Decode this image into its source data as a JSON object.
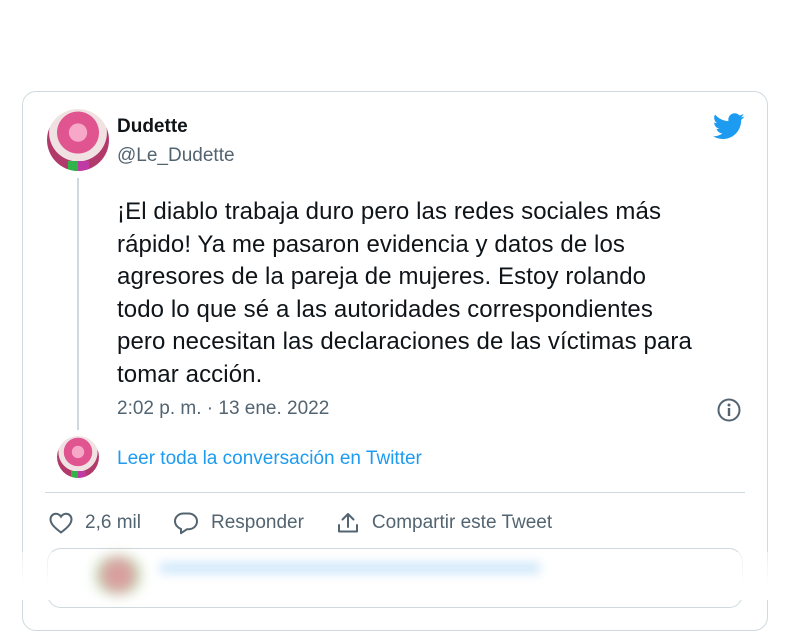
{
  "author": {
    "name": "Dudette",
    "handle": "@Le_Dudette"
  },
  "tweet": {
    "text_lines": [
      "¡El diablo trabaja duro pero las redes sociales más",
      "rápido! Ya me pasaron evidencia y datos de los",
      "agresores de la pareja de mujeres. Estoy rolando",
      "todo lo que sé a las autoridades correspondientes",
      "pero necesitan las declaraciones de las víctimas para",
      "tomar acción."
    ],
    "timestamp": "2:02 p. m. · 13 ene. 2022"
  },
  "conversation_link": "Leer toda la conversación en Twitter",
  "actions": {
    "likes": "2,6 mil",
    "reply": "Responder",
    "share": "Compartir este Tweet"
  },
  "colors": {
    "accent": "#1d9bf0",
    "text": "#0f1419",
    "muted": "#536471",
    "border": "#cfd9de"
  },
  "icons": [
    "twitter-bird-icon",
    "info-icon",
    "heart-icon",
    "reply-icon",
    "share-icon"
  ]
}
